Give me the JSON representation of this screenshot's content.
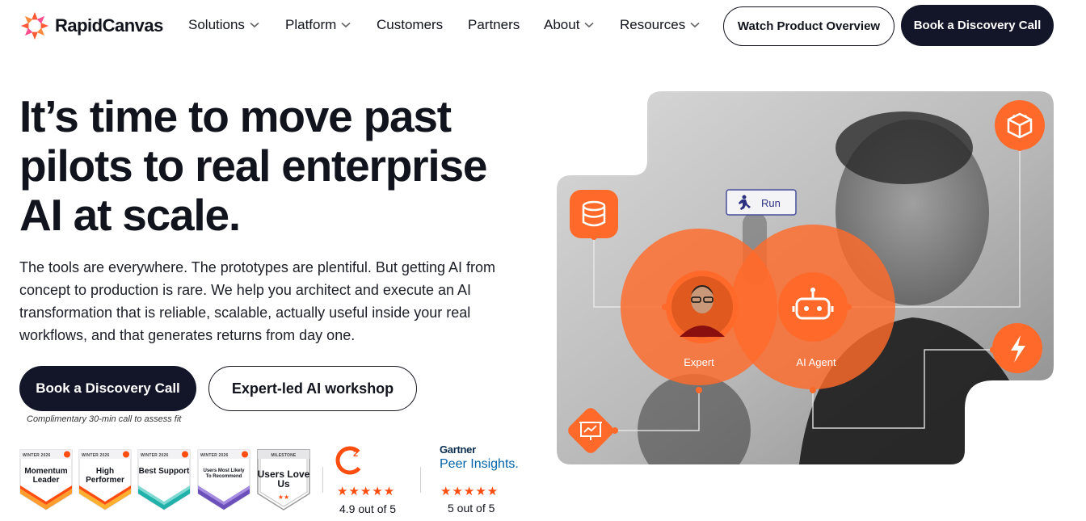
{
  "nav": {
    "brand": "RapidCanvas",
    "items": [
      {
        "label": "Solutions",
        "has_dropdown": true
      },
      {
        "label": "Platform",
        "has_dropdown": true
      },
      {
        "label": "Customers",
        "has_dropdown": false
      },
      {
        "label": "Partners",
        "has_dropdown": false
      },
      {
        "label": "About",
        "has_dropdown": true
      },
      {
        "label": "Resources",
        "has_dropdown": true
      }
    ],
    "cta_outline": "Watch Product Overview",
    "cta_primary": "Book a Discovery Call"
  },
  "hero": {
    "headline": "It’s time to move past pilots to real enterprise AI at scale.",
    "subtext": "The tools are everywhere. The prototypes are plentiful. But getting AI from concept to production is rare. We help you architect and execute an AI transformation that is reliable, scalable, actually useful inside your real workflows, and that generates returns from day one.",
    "primary_button": "Book a Discovery Call",
    "secondary_button": "Expert-led AI workshop",
    "primary_caption": "Complimentary 30-min call to assess fit"
  },
  "badges": [
    {
      "top": "WINTER 2026",
      "title": "Momentum Leader",
      "ribbon": "#ff9d2e",
      "accent": "#ff4d0f"
    },
    {
      "top": "WINTER 2026",
      "title": "High Performer",
      "ribbon": "#ffb02e",
      "accent": "#ff4d0f"
    },
    {
      "top": "WINTER 2026",
      "title": "Best Support",
      "ribbon": "#20b2aa",
      "accent": "#ff4d0f"
    },
    {
      "top": "WINTER 2026",
      "title": "Users Most Likely To Recommend",
      "ribbon": "#6b4fbb",
      "accent": "#ff4d0f"
    },
    {
      "top": "MILESTONE",
      "title": "Users Love Us",
      "ribbon": "#9a9a9a",
      "accent": "#ff4d0f"
    }
  ],
  "ratings": {
    "g2": {
      "stars": "★★★★★",
      "score": "4.9 out of 5",
      "logo_text": "2"
    },
    "gartner": {
      "brand": "Gartner",
      "product": "Peer Insights.",
      "stars": "★★★★★",
      "score": "5 out of 5"
    }
  },
  "visual": {
    "run_label": "Run",
    "expert_label": "Expert",
    "agent_label": "AI Agent",
    "icons": [
      "database-icon",
      "cube-icon",
      "lightning-icon",
      "presentation-icon",
      "robot-icon",
      "run-icon"
    ],
    "accent": "#ff6a2b"
  },
  "colors": {
    "primary_dark": "#121628",
    "accent_orange": "#ff6a2b",
    "text": "#12141d"
  }
}
